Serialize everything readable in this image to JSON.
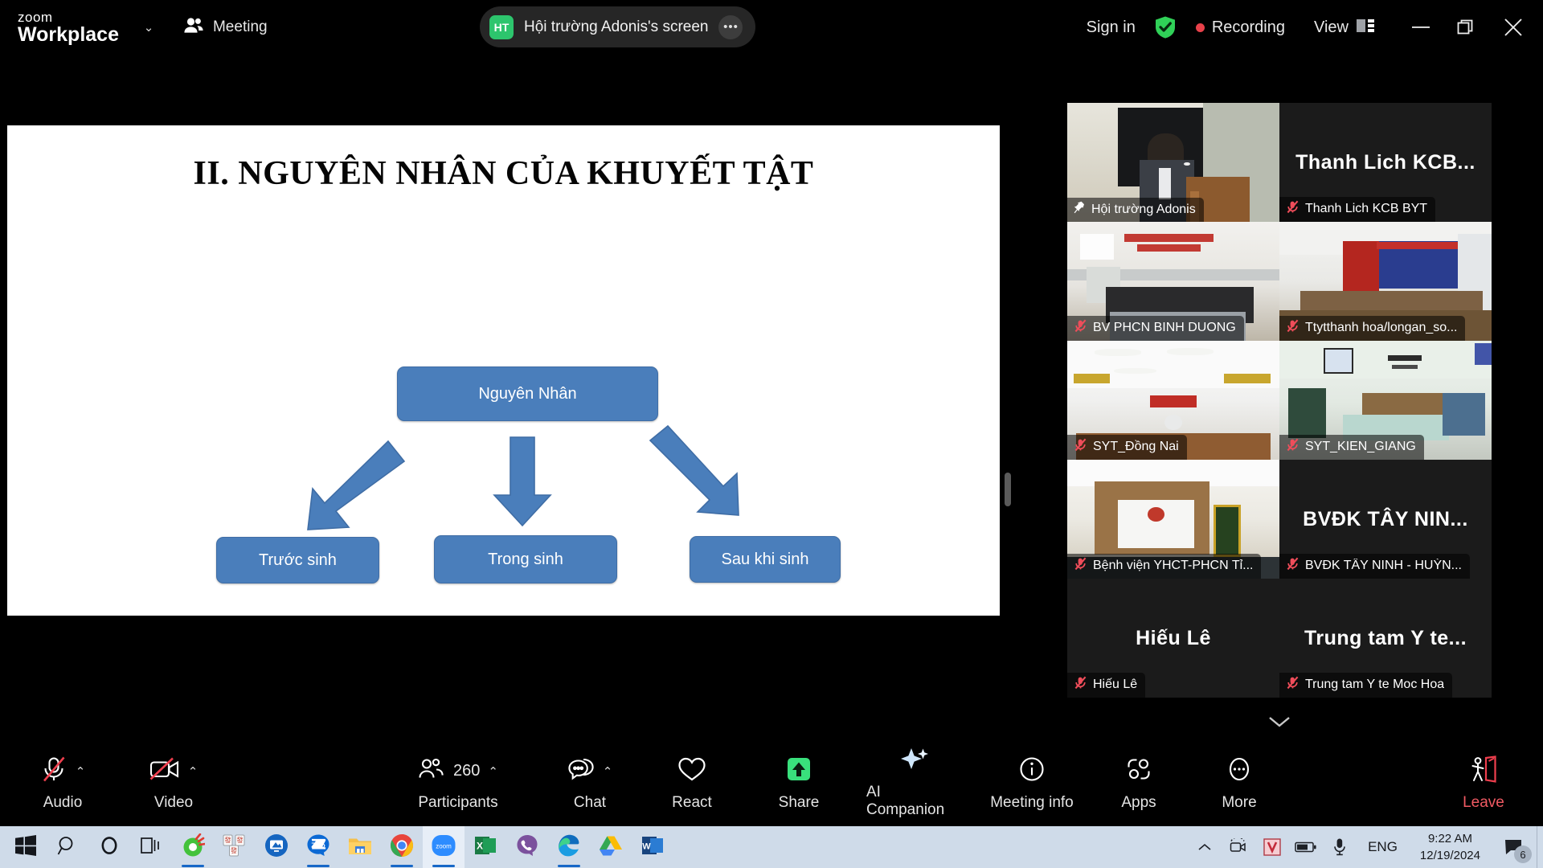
{
  "titlebar": {
    "brand_line1": "zoom",
    "brand_line2": "Workplace",
    "meeting_label": "Meeting",
    "share_avatar_initials": "HT",
    "share_title": "Hội trường Adonis's screen",
    "more_glyph": "•••",
    "sign_in": "Sign in",
    "recording_label": "Recording",
    "view_label": "View",
    "minimize_glyph": "—",
    "close_glyph": "✕",
    "caret_glyph": "⌄",
    "accent_green": "#2dc56d",
    "recording_red": "#e8414a"
  },
  "slide": {
    "title": "II. NGUYÊN NHÂN CỦA  KHUYẾT TẬT",
    "node_fill": "#4a7ebb",
    "nodes": [
      {
        "id": "root",
        "label": "Nguyên Nhân"
      },
      {
        "id": "before",
        "label": "Trước sinh"
      },
      {
        "id": "during",
        "label": "Trong sinh"
      },
      {
        "id": "after",
        "label": "Sau khi sinh"
      }
    ]
  },
  "gallery": {
    "tiles": [
      {
        "name": "Hội trường Adonis",
        "display": "video",
        "initials": "",
        "muted": false,
        "pinned": true,
        "active": true,
        "scene": "podium"
      },
      {
        "name": "Thanh Lich KCB BYT",
        "display": "name",
        "initials": "Thanh Lich KCB...",
        "muted": true,
        "pinned": false,
        "active": false,
        "scene": "none"
      },
      {
        "name": "BV PHCN BINH DUONG",
        "display": "video",
        "initials": "",
        "muted": true,
        "pinned": false,
        "active": false,
        "scene": "hall-a"
      },
      {
        "name": "Ttytthanh hoa/longan_so...",
        "display": "video",
        "initials": "",
        "muted": true,
        "pinned": false,
        "active": false,
        "scene": "hall-b"
      },
      {
        "name": "SYT_Đồng Nai",
        "display": "video",
        "initials": "",
        "muted": true,
        "pinned": false,
        "active": false,
        "scene": "hall-c"
      },
      {
        "name": "SYT_KIEN_GIANG",
        "display": "video",
        "initials": "",
        "muted": true,
        "pinned": false,
        "active": false,
        "scene": "hall-d"
      },
      {
        "name": "Bệnh viện YHCT-PHCN Tỉ...",
        "display": "video",
        "initials": "",
        "muted": true,
        "pinned": false,
        "active": false,
        "scene": "hall-e"
      },
      {
        "name": "BVĐK TÂY NINH - HUỲN...",
        "display": "name",
        "initials": "BVĐK TÂY NIN...",
        "muted": true,
        "pinned": false,
        "active": false,
        "scene": "none"
      },
      {
        "name": "Hiếu Lê",
        "display": "name",
        "initials": "Hiếu Lê",
        "muted": true,
        "pinned": false,
        "active": false,
        "scene": "none"
      },
      {
        "name": "Trung tam Y te Moc Hoa",
        "display": "name",
        "initials": "Trung tam Y te...",
        "muted": true,
        "pinned": false,
        "active": false,
        "scene": "none"
      }
    ],
    "more_caret": "⌄",
    "active_border": "#5df0a0",
    "mute_red": "#ef4d5a"
  },
  "toolbar": {
    "items": [
      {
        "id": "audio",
        "label": "Audio",
        "icon": "microphone-muted-icon",
        "has_caret": true,
        "badge": ""
      },
      {
        "id": "video",
        "label": "Video",
        "icon": "camera-off-icon",
        "has_caret": true,
        "badge": ""
      },
      {
        "id": "participants",
        "label": "Participants",
        "icon": "people-icon",
        "has_caret": true,
        "badge": "260"
      },
      {
        "id": "chat",
        "label": "Chat",
        "icon": "chat-bubble-icon",
        "has_caret": true,
        "badge": ""
      },
      {
        "id": "react",
        "label": "React",
        "icon": "heart-icon",
        "has_caret": false,
        "badge": ""
      },
      {
        "id": "share",
        "label": "Share",
        "icon": "share-screen-icon",
        "has_caret": false,
        "badge": ""
      },
      {
        "id": "ai-companion",
        "label": "AI Companion",
        "icon": "sparkle-icon",
        "has_caret": false,
        "badge": ""
      },
      {
        "id": "meeting-info",
        "label": "Meeting info",
        "icon": "info-icon",
        "has_caret": false,
        "badge": ""
      },
      {
        "id": "apps",
        "label": "Apps",
        "icon": "apps-icon",
        "has_caret": false,
        "badge": ""
      },
      {
        "id": "more",
        "label": "More",
        "icon": "ellipsis-icon",
        "has_caret": false,
        "badge": ""
      },
      {
        "id": "leave",
        "label": "Leave",
        "icon": "leave-door-icon",
        "has_caret": false,
        "badge": ""
      }
    ],
    "caret_glyph": "⌃",
    "leave_red": "#f05a63",
    "share_green": "#39e07c"
  },
  "taskbar": {
    "apps": [
      {
        "id": "start",
        "icon": "windows-start-icon",
        "running": false,
        "active": false
      },
      {
        "id": "search",
        "icon": "search-icon",
        "running": false,
        "active": false
      },
      {
        "id": "cortana",
        "icon": "cortana-circle-icon",
        "running": false,
        "active": false
      },
      {
        "id": "task-view",
        "icon": "task-view-icon",
        "running": false,
        "active": false
      },
      {
        "id": "unikey",
        "icon": "unikey-icon",
        "running": true,
        "active": false
      },
      {
        "id": "mahjong",
        "icon": "mahjong-icon",
        "running": false,
        "active": false
      },
      {
        "id": "ultraviewer",
        "icon": "ultraviewer-icon",
        "running": false,
        "active": false
      },
      {
        "id": "zalo",
        "icon": "zalo-icon",
        "running": true,
        "active": false
      },
      {
        "id": "file-explorer",
        "icon": "folder-icon",
        "running": false,
        "active": false
      },
      {
        "id": "chrome",
        "icon": "chrome-icon",
        "running": true,
        "active": false
      },
      {
        "id": "zoom",
        "icon": "zoom-icon",
        "running": true,
        "active": true
      },
      {
        "id": "excel",
        "icon": "excel-icon",
        "running": false,
        "active": false
      },
      {
        "id": "viber",
        "icon": "viber-icon",
        "running": false,
        "active": false
      },
      {
        "id": "edge",
        "icon": "edge-icon",
        "running": true,
        "active": false
      },
      {
        "id": "google-drive",
        "icon": "drive-icon",
        "running": false,
        "active": false
      },
      {
        "id": "word",
        "icon": "word-icon",
        "running": false,
        "active": false
      }
    ],
    "tray": {
      "overflow_caret": "⌃",
      "icons": [
        {
          "id": "overflow",
          "icon": "chevron-up-icon"
        },
        {
          "id": "camera-tray",
          "icon": "camera-tray-icon"
        },
        {
          "id": "unikey-tray",
          "icon": "unikey-v-icon"
        },
        {
          "id": "battery",
          "icon": "battery-icon"
        },
        {
          "id": "microphone-tray",
          "icon": "microphone-icon"
        }
      ],
      "language": "ENG",
      "time": "9:22 AM",
      "date": "12/19/2024",
      "notification_count": "6"
    }
  }
}
